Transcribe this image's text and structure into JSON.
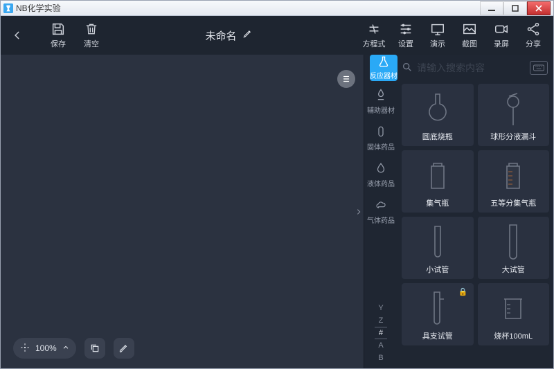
{
  "window": {
    "title": "NB化学实验"
  },
  "toolbar": {
    "save": "保存",
    "clear": "清空",
    "doc_title": "未命名",
    "equation": "方程式",
    "settings": "设置",
    "present": "演示",
    "capture": "截图",
    "record": "录屏",
    "share": "分享"
  },
  "zoom": {
    "value": "100%"
  },
  "panel": {
    "active_category": "反应器材",
    "search_placeholder": "请输入搜索内容",
    "categories": [
      {
        "label": "辅助器材"
      },
      {
        "label": "固体药品"
      },
      {
        "label": "液体药品"
      },
      {
        "label": "气体药品"
      }
    ],
    "index": [
      "Y",
      "Z",
      "#",
      "A",
      "B"
    ],
    "index_active": "#",
    "items": [
      {
        "name": "圆底烧瓶",
        "locked": false
      },
      {
        "name": "球形分液漏斗",
        "locked": false
      },
      {
        "name": "集气瓶",
        "locked": false
      },
      {
        "name": "五等分集气瓶",
        "locked": false
      },
      {
        "name": "小试管",
        "locked": false
      },
      {
        "name": "大试管",
        "locked": false
      },
      {
        "name": "具支试管",
        "locked": true
      },
      {
        "name": "烧杯100mL",
        "locked": false
      }
    ]
  }
}
